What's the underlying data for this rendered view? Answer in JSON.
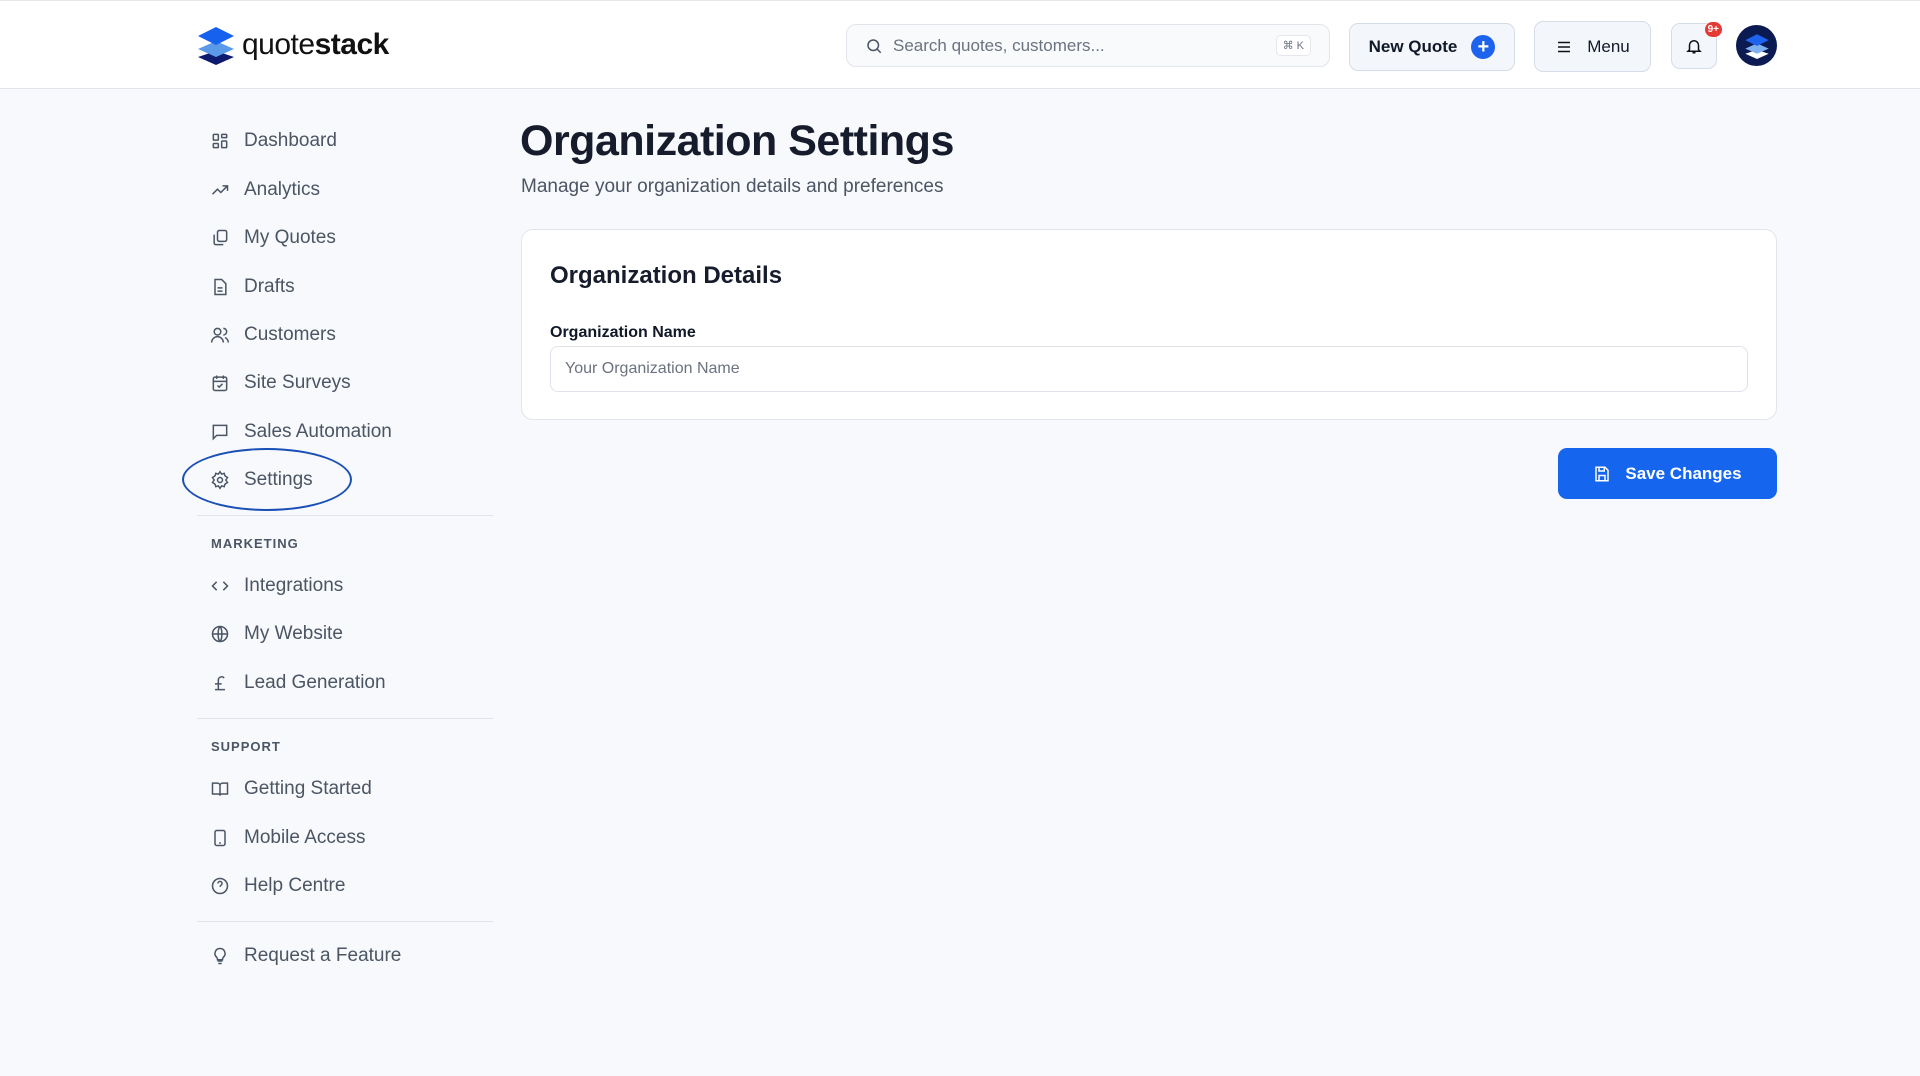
{
  "brand": {
    "name_light": "quote",
    "name_bold": "stack"
  },
  "header": {
    "search_placeholder": "Search quotes, customers...",
    "search_shortcut": "⌘ K",
    "new_quote_label": "New Quote",
    "menu_label": "Menu",
    "notification_badge": "9+"
  },
  "sidebar": {
    "main": [
      {
        "label": "Dashboard",
        "icon": "dashboard-icon"
      },
      {
        "label": "Analytics",
        "icon": "trending-up-icon"
      },
      {
        "label": "My Quotes",
        "icon": "quotes-icon"
      },
      {
        "label": "Drafts",
        "icon": "file-icon"
      },
      {
        "label": "Customers",
        "icon": "users-icon"
      },
      {
        "label": "Site Surveys",
        "icon": "calendar-check-icon"
      },
      {
        "label": "Sales Automation",
        "icon": "message-icon"
      },
      {
        "label": "Settings",
        "icon": "gear-icon"
      }
    ],
    "marketing_heading": "MARKETING",
    "marketing": [
      {
        "label": "Integrations",
        "icon": "code-icon"
      },
      {
        "label": "My Website",
        "icon": "globe-icon"
      },
      {
        "label": "Lead Generation",
        "icon": "pound-icon"
      }
    ],
    "support_heading": "SUPPORT",
    "support": [
      {
        "label": "Getting Started",
        "icon": "book-icon"
      },
      {
        "label": "Mobile Access",
        "icon": "phone-icon"
      },
      {
        "label": "Help Centre",
        "icon": "help-icon"
      }
    ],
    "request_feature": "Request a Feature"
  },
  "main": {
    "title": "Organization Settings",
    "subtitle": "Manage your organization details and preferences",
    "card_title": "Organization Details",
    "org_name_label": "Organization Name",
    "org_name_value": "",
    "org_name_placeholder": "Your Organization Name",
    "save_label": "Save Changes"
  },
  "colors": {
    "accent": "#1565ef",
    "annotation": "#1a4fb5"
  }
}
